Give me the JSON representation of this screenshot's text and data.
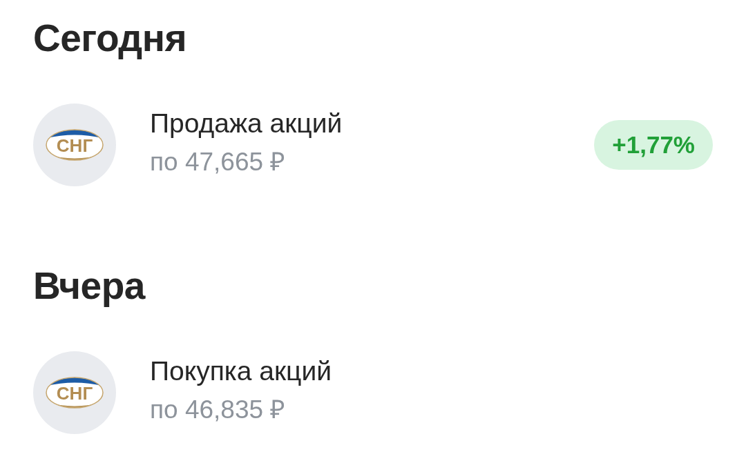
{
  "sections": [
    {
      "title": "Сегодня",
      "operations": [
        {
          "logo": "СНГ",
          "title": "Продажа акций",
          "price": "по 47,665 ₽",
          "change": "+1,77%"
        }
      ]
    },
    {
      "title": "Вчера",
      "operations": [
        {
          "logo": "СНГ",
          "title": "Покупка акций",
          "price": "по 46,835 ₽"
        }
      ]
    }
  ]
}
